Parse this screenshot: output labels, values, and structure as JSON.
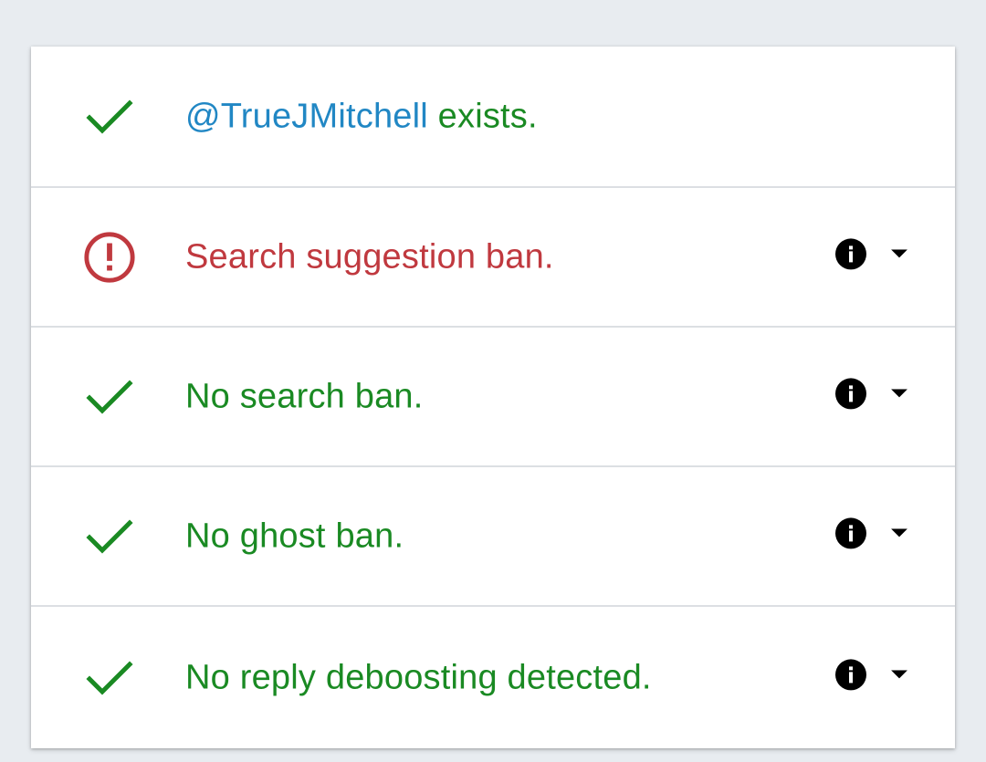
{
  "colors": {
    "ok": "#1a8a23",
    "bad": "#c0393f",
    "handle": "#2187c4",
    "background": "#e8ecf0"
  },
  "rows": [
    {
      "status": "ok",
      "icon": "checkmark-icon",
      "handle": "@TrueJMitchell",
      "text": " exists.",
      "has_actions": false
    },
    {
      "status": "bad",
      "icon": "alert-circle-icon",
      "text": "Search suggestion ban.",
      "has_actions": true
    },
    {
      "status": "ok",
      "icon": "checkmark-icon",
      "text": "No search ban.",
      "has_actions": true
    },
    {
      "status": "ok",
      "icon": "checkmark-icon",
      "text": "No ghost ban.",
      "has_actions": true
    },
    {
      "status": "ok",
      "icon": "checkmark-icon",
      "text": "No reply deboosting detected.",
      "has_actions": true
    }
  ]
}
